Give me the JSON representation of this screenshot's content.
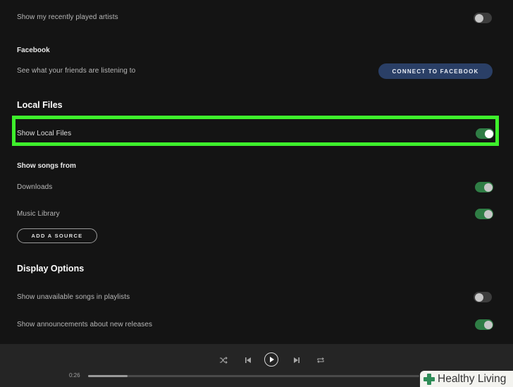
{
  "social": {
    "recent_artists_label": "Show my recently played artists",
    "recent_artists_on": false
  },
  "facebook": {
    "heading": "Facebook",
    "description": "See what your friends are listening to",
    "connect_label": "CONNECT TO FACEBOOK"
  },
  "local_files": {
    "heading": "Local Files",
    "show_label": "Show Local Files",
    "show_on": true,
    "sources_heading": "Show songs from",
    "sources": [
      {
        "label": "Downloads",
        "on": true
      },
      {
        "label": "Music Library",
        "on": true
      }
    ],
    "add_source_label": "ADD A SOURCE"
  },
  "display": {
    "heading": "Display Options",
    "unavailable_label": "Show unavailable songs in playlists",
    "unavailable_on": false,
    "announcements_label": "Show announcements about new releases",
    "announcements_on": true
  },
  "player": {
    "elapsed": "0:26",
    "progress_fraction": 0.12,
    "icons": [
      "shuffle-icon",
      "previous-icon",
      "play-icon",
      "next-icon",
      "repeat-icon"
    ]
  },
  "watermark": {
    "text": "Healthy Living"
  },
  "colors": {
    "highlight": "#3ef02c",
    "toggle_on": "#2f7d45",
    "facebook_button": "#2a3f66"
  }
}
